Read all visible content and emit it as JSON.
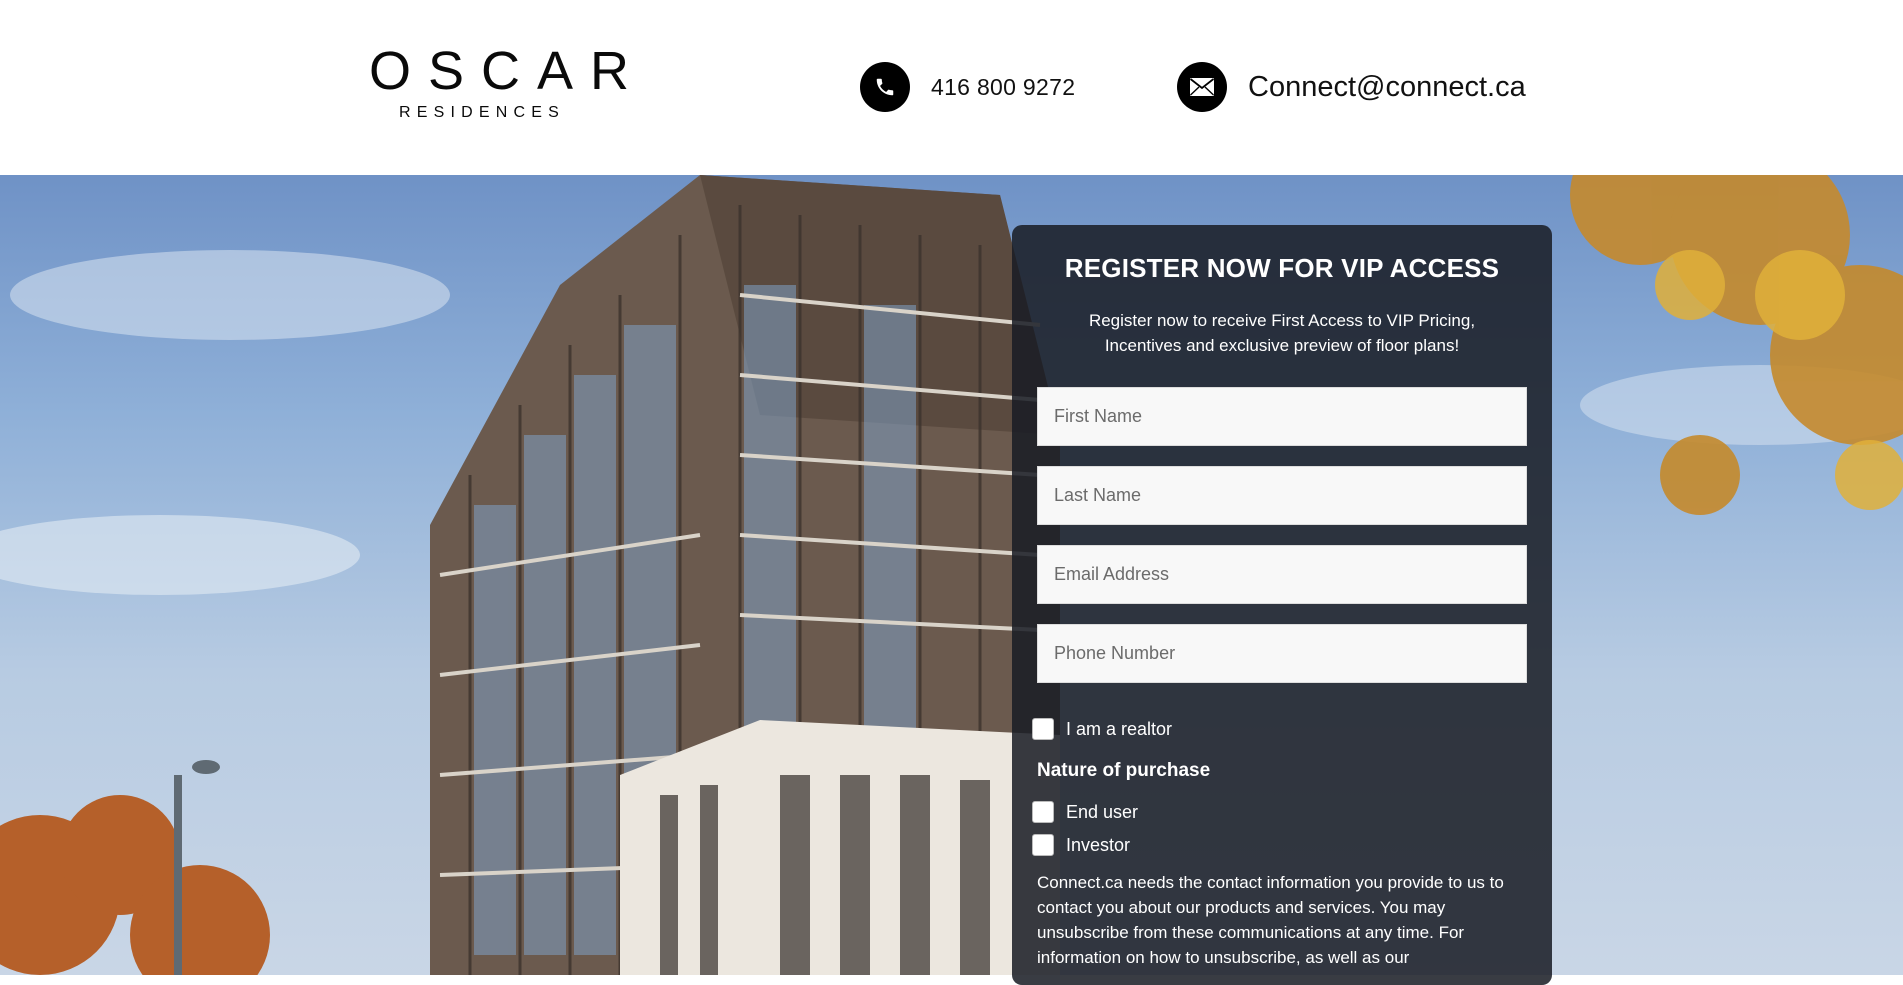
{
  "header": {
    "logo_main": "OSCAR",
    "logo_sub": "RESIDENCES",
    "phone": "416 800 9272",
    "email": "Connect@connect.ca",
    "phone_icon": "phone-icon",
    "email_icon": "envelope-icon"
  },
  "form": {
    "title": "REGISTER NOW FOR VIP ACCESS",
    "subtitle": "Register now to receive First Access to VIP Pricing, Incentives and exclusive preview of floor plans!",
    "fields": {
      "first_name_placeholder": "First Name",
      "last_name_placeholder": "Last Name",
      "email_placeholder": "Email Address",
      "phone_placeholder": "Phone Number"
    },
    "realtor_label": "I am a realtor",
    "purchase_heading": "Nature of purchase",
    "purchase_options": [
      "End user",
      "Investor"
    ],
    "consent_text": "Connect.ca needs the contact information you provide to us to contact you about our products and services. You may unsubscribe from these communications at any time. For information on how to unsubscribe, as well as our"
  },
  "colors": {
    "header_bg": "#ffffff",
    "panel_bg": "#181c24",
    "icon_bg": "#000000",
    "field_bg": "#f8f8f8"
  }
}
